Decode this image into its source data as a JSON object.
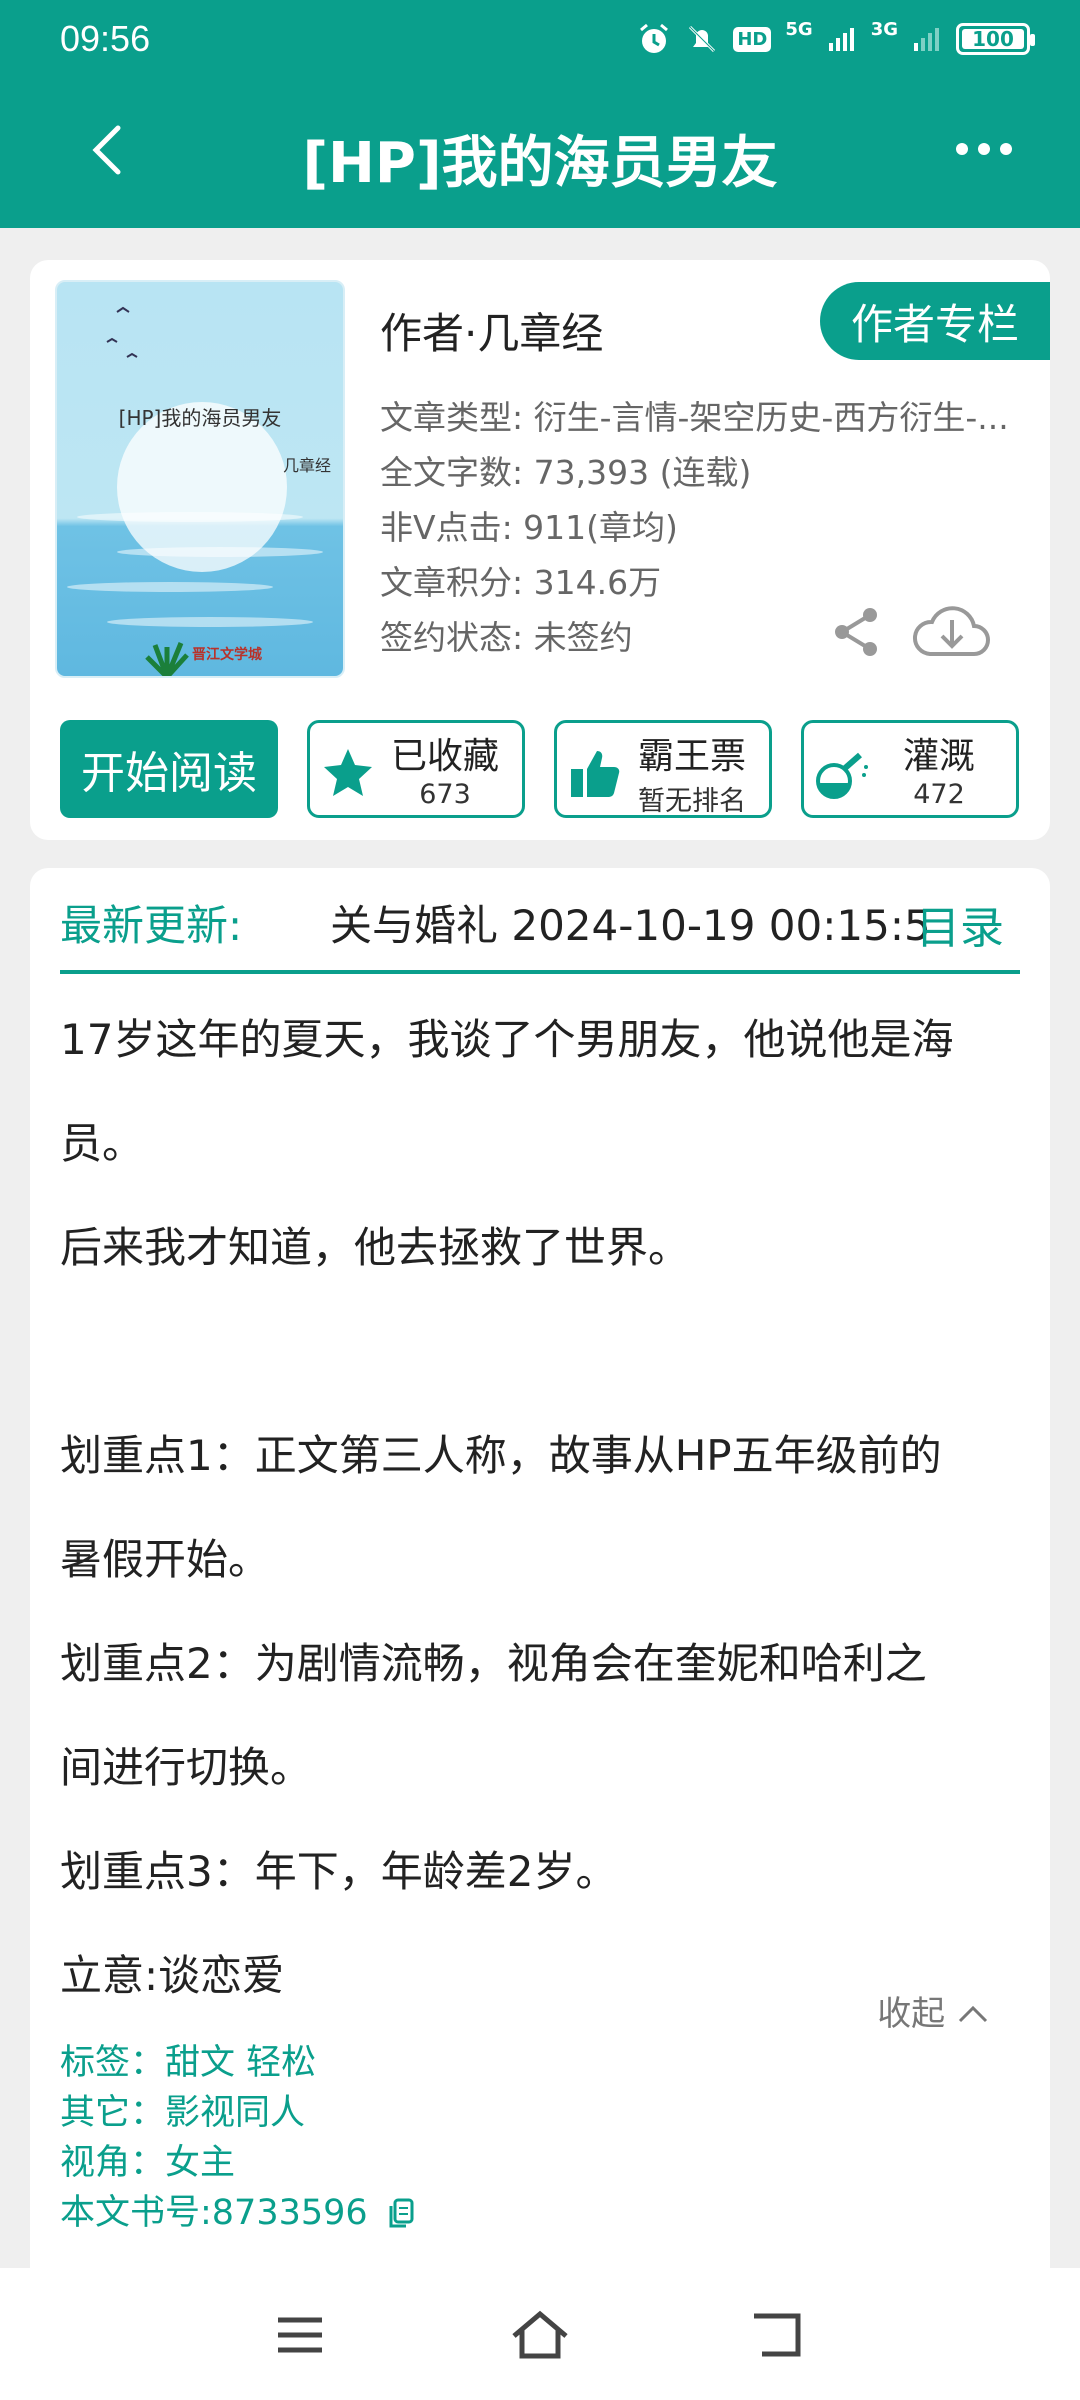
{
  "status": {
    "time": "09:56",
    "battery": "100",
    "network1": "5G",
    "network2": "3G",
    "hd": "HD"
  },
  "header": {
    "title": "[HP]我的海员男友"
  },
  "book": {
    "cover_title": "[HP]我的海员男友",
    "cover_author": "几章经",
    "cover_logo": "晋江文学城",
    "author_line": "作者·几章经",
    "column_button": "作者专栏",
    "meta": [
      "文章类型: 衍生-言情-架空历史-西方衍生-...",
      "全文字数: 73,393 (连载)",
      "非Ⅴ点击: 911(章均)",
      "文章积分: 314.6万",
      "签约状态: 未签约"
    ]
  },
  "actions": {
    "read": "开始阅读",
    "favorite": {
      "label": "已收藏",
      "count": "673"
    },
    "ticket": {
      "label": "霸王票",
      "count": "暂无排名"
    },
    "nutrient": {
      "label": "灌溉",
      "count": "472"
    }
  },
  "latest": {
    "label": "最新更新:",
    "value": "关与婚礼 2024-10-19 00:15:5",
    "toc": "目录"
  },
  "intro_paragraphs": [
    "17岁这年的夏天，我谈了个男朋友，他说他是海",
    "员。",
    "后来我才知道，他去拯救了世界。",
    "",
    "划重点1：正文第三人称，故事从HP五年级前的",
    "暑假开始。",
    "划重点2：为剧情流畅，视角会在奎妮和哈利之",
    "间进行切换。",
    "划重点3：年下，年龄差2岁。",
    "立意:谈恋爱"
  ],
  "collapse": "收起",
  "tags": {
    "tags": "标签：甜文 轻松",
    "other": "其它：影视同人",
    "view": "视角：女主",
    "book_id": "本文书号:8733596"
  },
  "colors": {
    "accent": "#0a9f8c",
    "background": "#efefef"
  }
}
